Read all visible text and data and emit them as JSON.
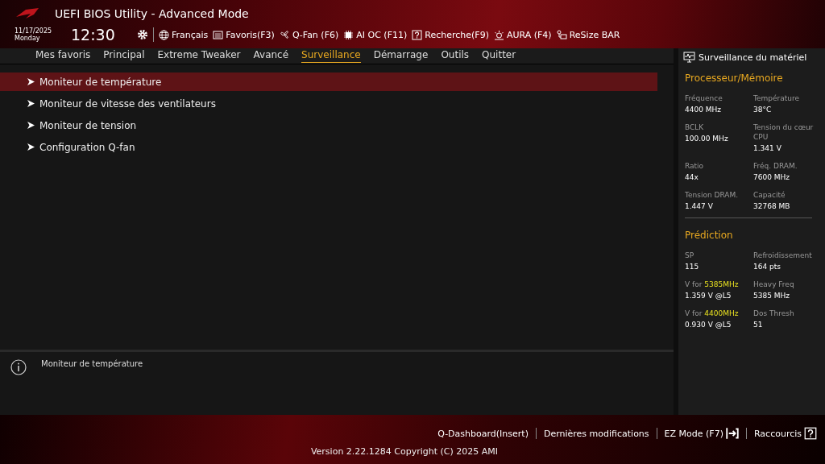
{
  "header": {
    "title": "UEFI BIOS Utility - Advanced Mode",
    "date": "11/17/2025",
    "day": "Monday",
    "time": "12:30",
    "tools": [
      {
        "kind": "globe",
        "label": "Français"
      },
      {
        "kind": "folder",
        "label": "Favoris(F3)"
      },
      {
        "kind": "fan",
        "label": "Q-Fan (F6)"
      },
      {
        "kind": "chip",
        "label": "AI OC (F11)"
      },
      {
        "kind": "help",
        "label": "Recherche(F9)"
      },
      {
        "kind": "aura",
        "label": "AURA (F4)"
      },
      {
        "kind": "bar",
        "label": "ReSize BAR"
      }
    ]
  },
  "tabs": [
    {
      "label": "Mes favoris",
      "selected": false
    },
    {
      "label": "Principal",
      "selected": false
    },
    {
      "label": "Extreme Tweaker",
      "selected": false
    },
    {
      "label": "Avancé",
      "selected": false
    },
    {
      "label": "Surveillance",
      "selected": true
    },
    {
      "label": "Démarrage",
      "selected": false
    },
    {
      "label": "Outils",
      "selected": false
    },
    {
      "label": "Quitter",
      "selected": false
    }
  ],
  "menu": [
    {
      "label": "Moniteur de température",
      "selected": true
    },
    {
      "label": "Moniteur de vitesse des ventilateurs",
      "selected": false
    },
    {
      "label": "Moniteur de tension",
      "selected": false
    },
    {
      "label": "Configuration Q-fan",
      "selected": false
    }
  ],
  "help_text": "Moniteur de température",
  "monitor": {
    "title": "Surveillance du matériel",
    "sections": [
      {
        "title": "Processeur/Mémoire",
        "items": [
          {
            "label": "Fréquence",
            "value": "4400 MHz"
          },
          {
            "label": "Température",
            "value": "38°C"
          },
          {
            "label": "BCLK",
            "value": "100.00 MHz"
          },
          {
            "label": "Tension du cœur CPU",
            "value": "1.341 V"
          },
          {
            "label": "Ratio",
            "value": "44x"
          },
          {
            "label": "Fréq. DRAM.",
            "value": "7600 MHz"
          },
          {
            "label": "Tension DRAM.",
            "value": "1.447 V"
          },
          {
            "label": "Capacité",
            "value": "32768 MB"
          }
        ]
      },
      {
        "title": "Prédiction",
        "items": [
          {
            "label": "SP",
            "value": "115"
          },
          {
            "label": "Refroidissement",
            "value": "164 pts"
          },
          {
            "label": "V for ",
            "highlight": "5385MHz",
            "value": "1.359 V @L5"
          },
          {
            "label": "Heavy Freq",
            "value": "5385 MHz"
          },
          {
            "label": "V for ",
            "highlight": "4400MHz",
            "value": "0.930 V @L5"
          },
          {
            "label": "Dos Thresh",
            "value": "51"
          }
        ]
      }
    ]
  },
  "footer": {
    "links": [
      {
        "kind": "text",
        "label": "Q-Dashboard(Insert)"
      },
      {
        "kind": "text",
        "label": "Dernières modifications"
      },
      {
        "kind": "exit",
        "label": "EZ Mode (F7)"
      },
      {
        "kind": "help",
        "label": "Raccourcis"
      }
    ],
    "version": "Version 2.22.1284 Copyright (C) 2025 AMI"
  }
}
